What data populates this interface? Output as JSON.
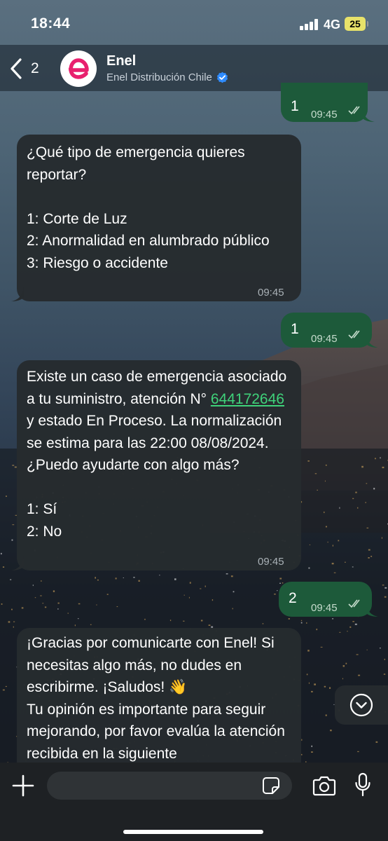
{
  "status_bar": {
    "time": "18:44",
    "network": "4G",
    "battery": "25"
  },
  "header": {
    "back_count": "2",
    "contact_name": "Enel",
    "contact_subtitle": "Enel Distribución Chile"
  },
  "messages": [
    {
      "direction": "out",
      "text": "1",
      "time": "09:45",
      "status": "read"
    },
    {
      "direction": "in",
      "text": "¿Qué tipo de emergencia quieres reportar?\n\n1: Corte de Luz\n2: Anormalidad en alumbrado público\n3: Riesgo o accidente",
      "time": "09:45"
    },
    {
      "direction": "out",
      "text": "1",
      "time": "09:45",
      "status": "read"
    },
    {
      "direction": "in",
      "text_before": "Existe un caso de emergencia asociado a tu suministro, atención N° ",
      "link": "644172646",
      "text_after": " y estado En Proceso. La normalización se estima para las 22:00 08/08/2024. ¿Puedo ayudarte con algo más?\n\n1: Sí\n2: No",
      "time": "09:45"
    },
    {
      "direction": "out",
      "text": "2",
      "time": "09:45",
      "status": "read"
    },
    {
      "direction": "in",
      "text": "¡Gracias por comunicarte con Enel! Si necesitas algo más, no dudes en escribirme. ¡Saludos! 👋\nTu opinión es importante para seguir mejorando, por favor evalúa la atención recibida en la siguiente"
    }
  ],
  "composer": {
    "placeholder": ""
  },
  "colors": {
    "incoming_bubble": "#262b2e",
    "outgoing_bubble": "#1d5a3a",
    "link": "#3fd27a",
    "brand": "#e8206e",
    "verified": "#2f8cff"
  },
  "icons": [
    "chevron-left-icon",
    "enel-logo",
    "verified-badge-icon",
    "double-check-icon",
    "chevron-down-icon",
    "plus-icon",
    "sticker-icon",
    "camera-icon",
    "mic-icon"
  ]
}
